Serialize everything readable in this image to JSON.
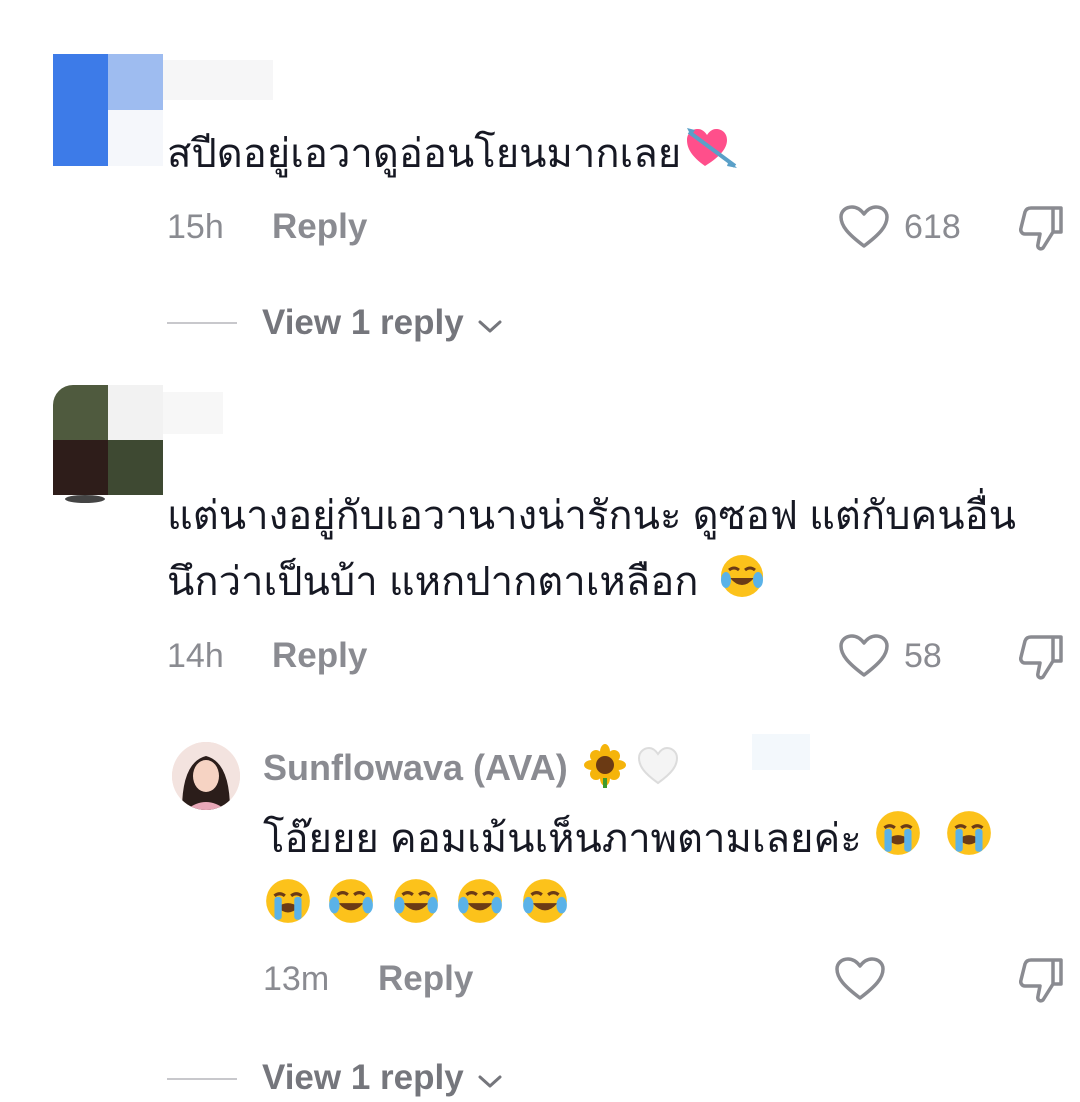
{
  "comments": [
    {
      "text": "สปีดอยู่เอวาดูอ่อนโยนมากเลย",
      "emoji": "heart-with-arrow",
      "time": "15h",
      "reply_label": "Reply",
      "likes": "618",
      "view_replies": "View 1 reply"
    },
    {
      "text_line1": "แต่นางอยู่กับเอวานางน่ารักนะ ดูซอฟ แต่กับคนอื่น",
      "text_line2": "นึกว่าเป็นบ้า แหกปากตาเหลือก",
      "emoji": "face-with-tears-of-joy",
      "time": "14h",
      "reply_label": "Reply",
      "likes": "58",
      "replies": [
        {
          "username": "Sunflowava (AVA)",
          "username_emojis": [
            "sunflower",
            "white-heart"
          ],
          "text": "โอ๊ยยย คอมเม้นเห็นภาพตามเลยค่ะ",
          "emoji_line": [
            "loudly-crying-face",
            "loudly-crying-face",
            "loudly-crying-face",
            "face-with-tears-of-joy",
            "face-with-tears-of-joy",
            "face-with-tears-of-joy",
            "face-with-tears-of-joy"
          ],
          "time": "13m",
          "reply_label": "Reply"
        }
      ],
      "view_replies": "View 1 reply"
    }
  ],
  "colors": {
    "text": "#161823",
    "secondary": "#8a8b91",
    "avatar1_blue": "#3d7be8",
    "avatar1_light": "#9ebcf0"
  }
}
